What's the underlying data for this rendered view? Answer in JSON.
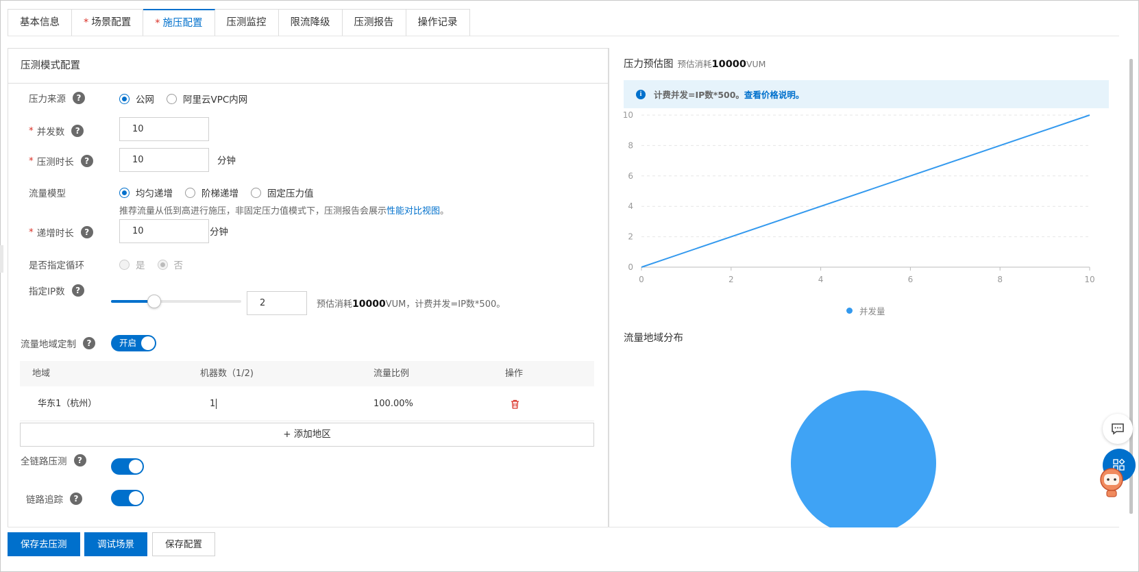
{
  "tabs": [
    {
      "label": "基本信息",
      "required": false,
      "active": false
    },
    {
      "label": "场景配置",
      "required": true,
      "active": false
    },
    {
      "label": "施压配置",
      "required": true,
      "active": true
    },
    {
      "label": "压测监控",
      "required": false,
      "active": false
    },
    {
      "label": "限流降级",
      "required": false,
      "active": false
    },
    {
      "label": "压测报告",
      "required": false,
      "active": false
    },
    {
      "label": "操作记录",
      "required": false,
      "active": false
    }
  ],
  "panel": {
    "title": "压测模式配置",
    "pressure_source": {
      "label": "压力来源",
      "options": [
        "公网",
        "阿里云VPC内网"
      ],
      "selected": "公网"
    },
    "concurrency": {
      "label": "并发数",
      "value": "10"
    },
    "duration": {
      "label": "压测时长",
      "value": "10",
      "unit": "分钟"
    },
    "traffic_model": {
      "label": "流量模型",
      "options": [
        "均匀递增",
        "阶梯递增",
        "固定压力值"
      ],
      "selected": "均匀递增",
      "hint": "推荐流量从低到高进行施压，非固定压力值模式下，压测报告会展示",
      "hint_link": "性能对比视图",
      "hint_end": "。"
    },
    "ramp": {
      "label": "递增时长",
      "value": "10",
      "unit": "分钟"
    },
    "loop": {
      "label": "是否指定循环",
      "options": [
        "是",
        "否"
      ],
      "selected": "否"
    },
    "ip": {
      "label": "指定IP数",
      "value": "2",
      "slider_fraction": 0.33,
      "note_pre": "预估消耗",
      "note_bold": "10000",
      "note_post": "VUM，计费并发=IP数*500。"
    },
    "region_custom": {
      "label": "流量地域定制",
      "toggle_label": "开启",
      "on": true
    },
    "region_table": {
      "headers": [
        "地域",
        "机器数（1/2)",
        "流量比例",
        "操作"
      ],
      "rows": [
        {
          "region": "华东1（杭州）",
          "machines": "1",
          "ratio": "100.00%"
        }
      ]
    },
    "add_region": "+ 添加地区",
    "full_link": {
      "label": "全链路压测",
      "on": true
    },
    "tracing": {
      "label": "链路追踪",
      "on": true
    }
  },
  "buttons": {
    "save_run": "保存去压测",
    "debug": "调试场景",
    "save": "保存配置"
  },
  "right": {
    "chart_title": "压力预估图",
    "chart_sub_pre": "预估消耗",
    "chart_sub_bold": "10000",
    "chart_sub_post": "VUM",
    "notice_text": "计费并发=IP数*500。",
    "notice_link": "查看价格说明。",
    "pie_title": "流量地域分布"
  },
  "colors": {
    "primary": "#0070cc",
    "series": "#3399ee",
    "danger": "#d93026"
  },
  "chart_data": [
    {
      "type": "line",
      "x": [
        0,
        10
      ],
      "series": [
        {
          "name": "并发量",
          "values": [
            0,
            10
          ]
        }
      ],
      "xticks": [
        0,
        2,
        4,
        6,
        8,
        10
      ],
      "yticks": [
        0,
        2,
        4,
        6,
        8,
        10
      ],
      "xlim": [
        0,
        10
      ],
      "ylim": [
        0,
        10
      ],
      "grid": true,
      "legend": "bottom-center"
    },
    {
      "type": "pie",
      "categories": [
        "华东1（杭州）"
      ],
      "values": [
        100
      ]
    }
  ]
}
